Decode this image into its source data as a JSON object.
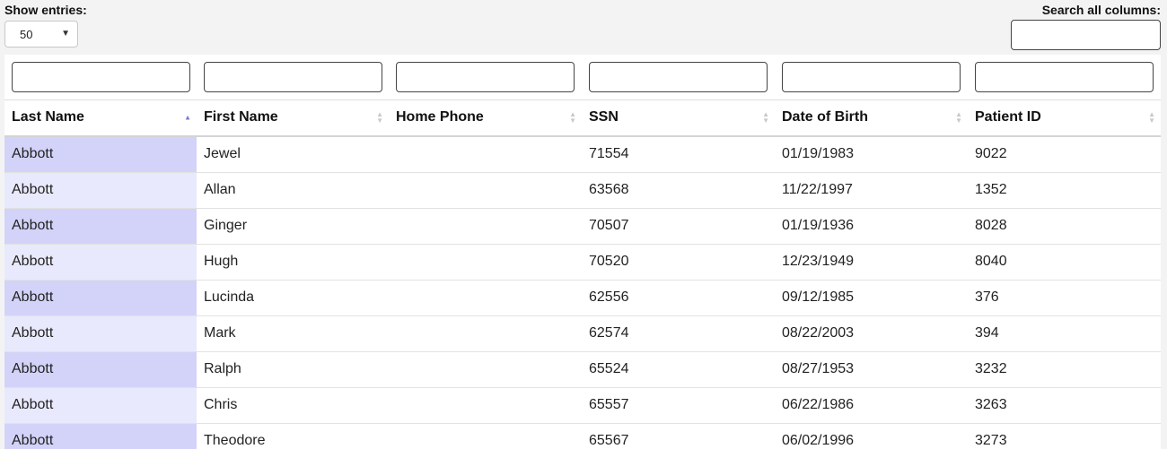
{
  "controls": {
    "show_entries_label": "Show entries:",
    "entries_value": "50",
    "search_label": "Search all columns:"
  },
  "table": {
    "columns": [
      "Last Name",
      "First Name",
      "Home Phone",
      "SSN",
      "Date of Birth",
      "Patient ID"
    ],
    "sorted_column": "Last Name",
    "sort_direction": "ascending",
    "rows": [
      [
        "Abbott",
        "Jewel",
        "",
        "71554",
        "01/19/1983",
        "9022"
      ],
      [
        "Abbott",
        "Allan",
        "",
        "63568",
        "11/22/1997",
        "1352"
      ],
      [
        "Abbott",
        "Ginger",
        "",
        "70507",
        "01/19/1936",
        "8028"
      ],
      [
        "Abbott",
        "Hugh",
        "",
        "70520",
        "12/23/1949",
        "8040"
      ],
      [
        "Abbott",
        "Lucinda",
        "",
        "62556",
        "09/12/1985",
        "376"
      ],
      [
        "Abbott",
        "Mark",
        "",
        "62574",
        "08/22/2003",
        "394"
      ],
      [
        "Abbott",
        "Ralph",
        "",
        "65524",
        "08/27/1953",
        "3232"
      ],
      [
        "Abbott",
        "Chris",
        "",
        "65557",
        "06/22/1986",
        "3263"
      ],
      [
        "Abbott",
        "Theodore",
        "",
        "65567",
        "06/02/1996",
        "3273"
      ]
    ]
  },
  "colors": {
    "sorted_odd": "#d3d3f9",
    "sorted_even": "#e9e9fd",
    "sort_active": "#7a7ad6"
  }
}
